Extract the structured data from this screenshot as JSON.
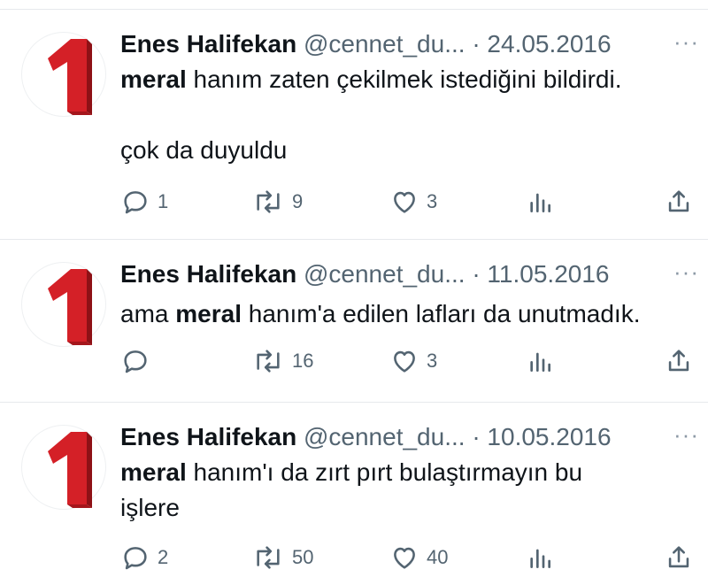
{
  "tweets": [
    {
      "author": "Enes Halifekan",
      "handle": "@cennet_du...",
      "separator": "·",
      "date": "24.05.2016",
      "more": "···",
      "text_bold": "meral",
      "text_line1_rest": " hanım zaten çekilmek istediğini bildirdi.",
      "text_line3": "çok da duyuldu",
      "replies": "1",
      "retweets": "9",
      "likes": "3"
    },
    {
      "author": "Enes Halifekan",
      "handle": "@cennet_du...",
      "separator": "·",
      "date": "11.05.2016",
      "more": "···",
      "text_prefix": "ama ",
      "text_bold": "meral",
      "text_line1_rest": " hanım'a edilen lafları da unutmadık.",
      "replies": "",
      "retweets": "16",
      "likes": "3"
    },
    {
      "author": "Enes Halifekan",
      "handle": "@cennet_du...",
      "separator": "·",
      "date": "10.05.2016",
      "more": "···",
      "text_bold": "meral",
      "text_line1_rest": " hanım'ı da zırt pırt bulaştırmayın bu",
      "text_line2": "işlere",
      "replies": "2",
      "retweets": "50",
      "likes": "40"
    }
  ],
  "avatar_glyph": "1",
  "icons": [
    "reply-icon",
    "retweet-icon",
    "like-icon",
    "views-icon",
    "share-icon",
    "more-icon"
  ],
  "colors": {
    "avatar_red": "#d42027",
    "muted": "#536471",
    "text": "#0f1419",
    "divider": "#e6e9ec"
  }
}
